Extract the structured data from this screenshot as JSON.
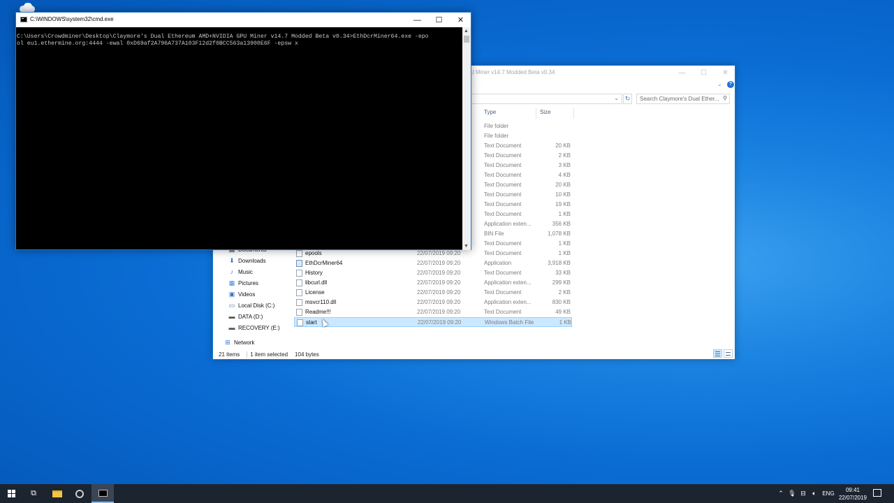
{
  "cmd": {
    "title": "C:\\WINDOWS\\system32\\cmd.exe",
    "line1": "C:\\Users\\Crowdminer\\Desktop\\Claymore's Dual Ethereum AMD+NVIDIA GPU Miner v14.7 Modded Beta v0.34>EthDcrMiner64.exe -epo",
    "line2": "ol eu1.ethermine.org:4444 -ewal 0xD69af2A796A737A103F12d2f0BCC563a13900E6F -epsw x",
    "min": "—",
    "max": "☐",
    "close": "✕"
  },
  "explorer": {
    "title_fragment": "U Miner v14.7 Modded Beta v0.34",
    "search_placeholder": "Search Claymore's Dual Ether...",
    "min": "—",
    "max": "☐",
    "close": "✕",
    "columns": {
      "type": "Type",
      "size": "Size"
    },
    "upper_rows": [
      {
        "type": "File folder",
        "size": ""
      },
      {
        "type": "File folder",
        "size": ""
      },
      {
        "type": "Text Document",
        "size": "20 KB"
      },
      {
        "type": "Text Document",
        "size": "2 KB"
      },
      {
        "type": "Text Document",
        "size": "3 KB"
      },
      {
        "type": "Text Document",
        "size": "4 KB"
      },
      {
        "type": "Text Document",
        "size": "20 KB"
      },
      {
        "type": "Text Document",
        "size": "10 KB"
      },
      {
        "type": "Text Document",
        "size": "19 KB"
      },
      {
        "type": "Text Document",
        "size": "1 KB"
      },
      {
        "type": "Application exten...",
        "size": "356 KB"
      },
      {
        "type": "BIN File",
        "size": "1,078 KB"
      },
      {
        "type": "Text Document",
        "size": "1 KB"
      }
    ],
    "rows": [
      {
        "name": "epools",
        "date": "22/07/2019 09:20",
        "type": "Text Document",
        "size": "1 KB"
      },
      {
        "name": "EthDcrMiner64",
        "date": "22/07/2019 09:20",
        "type": "Application",
        "size": "3,918 KB"
      },
      {
        "name": "History",
        "date": "22/07/2019 09:20",
        "type": "Text Document",
        "size": "33 KB"
      },
      {
        "name": "libcurl.dll",
        "date": "22/07/2019 09:20",
        "type": "Application exten...",
        "size": "299 KB"
      },
      {
        "name": "License",
        "date": "22/07/2019 09:20",
        "type": "Text Document",
        "size": "2 KB"
      },
      {
        "name": "msvcr110.dll",
        "date": "22/07/2019 09:20",
        "type": "Application exten...",
        "size": "830 KB"
      },
      {
        "name": "Readme!!!",
        "date": "22/07/2019 09:20",
        "type": "Text Document",
        "size": "49 KB"
      },
      {
        "name": "start",
        "date": "22/07/2019 09:20",
        "type": "Windows Batch File",
        "size": "1 KB"
      }
    ],
    "nav": {
      "documents": "Documents",
      "downloads": "Downloads",
      "music": "Music",
      "pictures": "Pictures",
      "videos": "Videos",
      "local_disk": "Local Disk (C:)",
      "data": "DATA (D:)",
      "recovery": "RECOVERY (E:)",
      "network": "Network"
    },
    "status": {
      "items": "21 items",
      "selected": "1 item selected",
      "size": "104 bytes"
    }
  },
  "taskbar": {
    "language": "ENG",
    "time": "09:41",
    "date": "22/07/2019"
  }
}
